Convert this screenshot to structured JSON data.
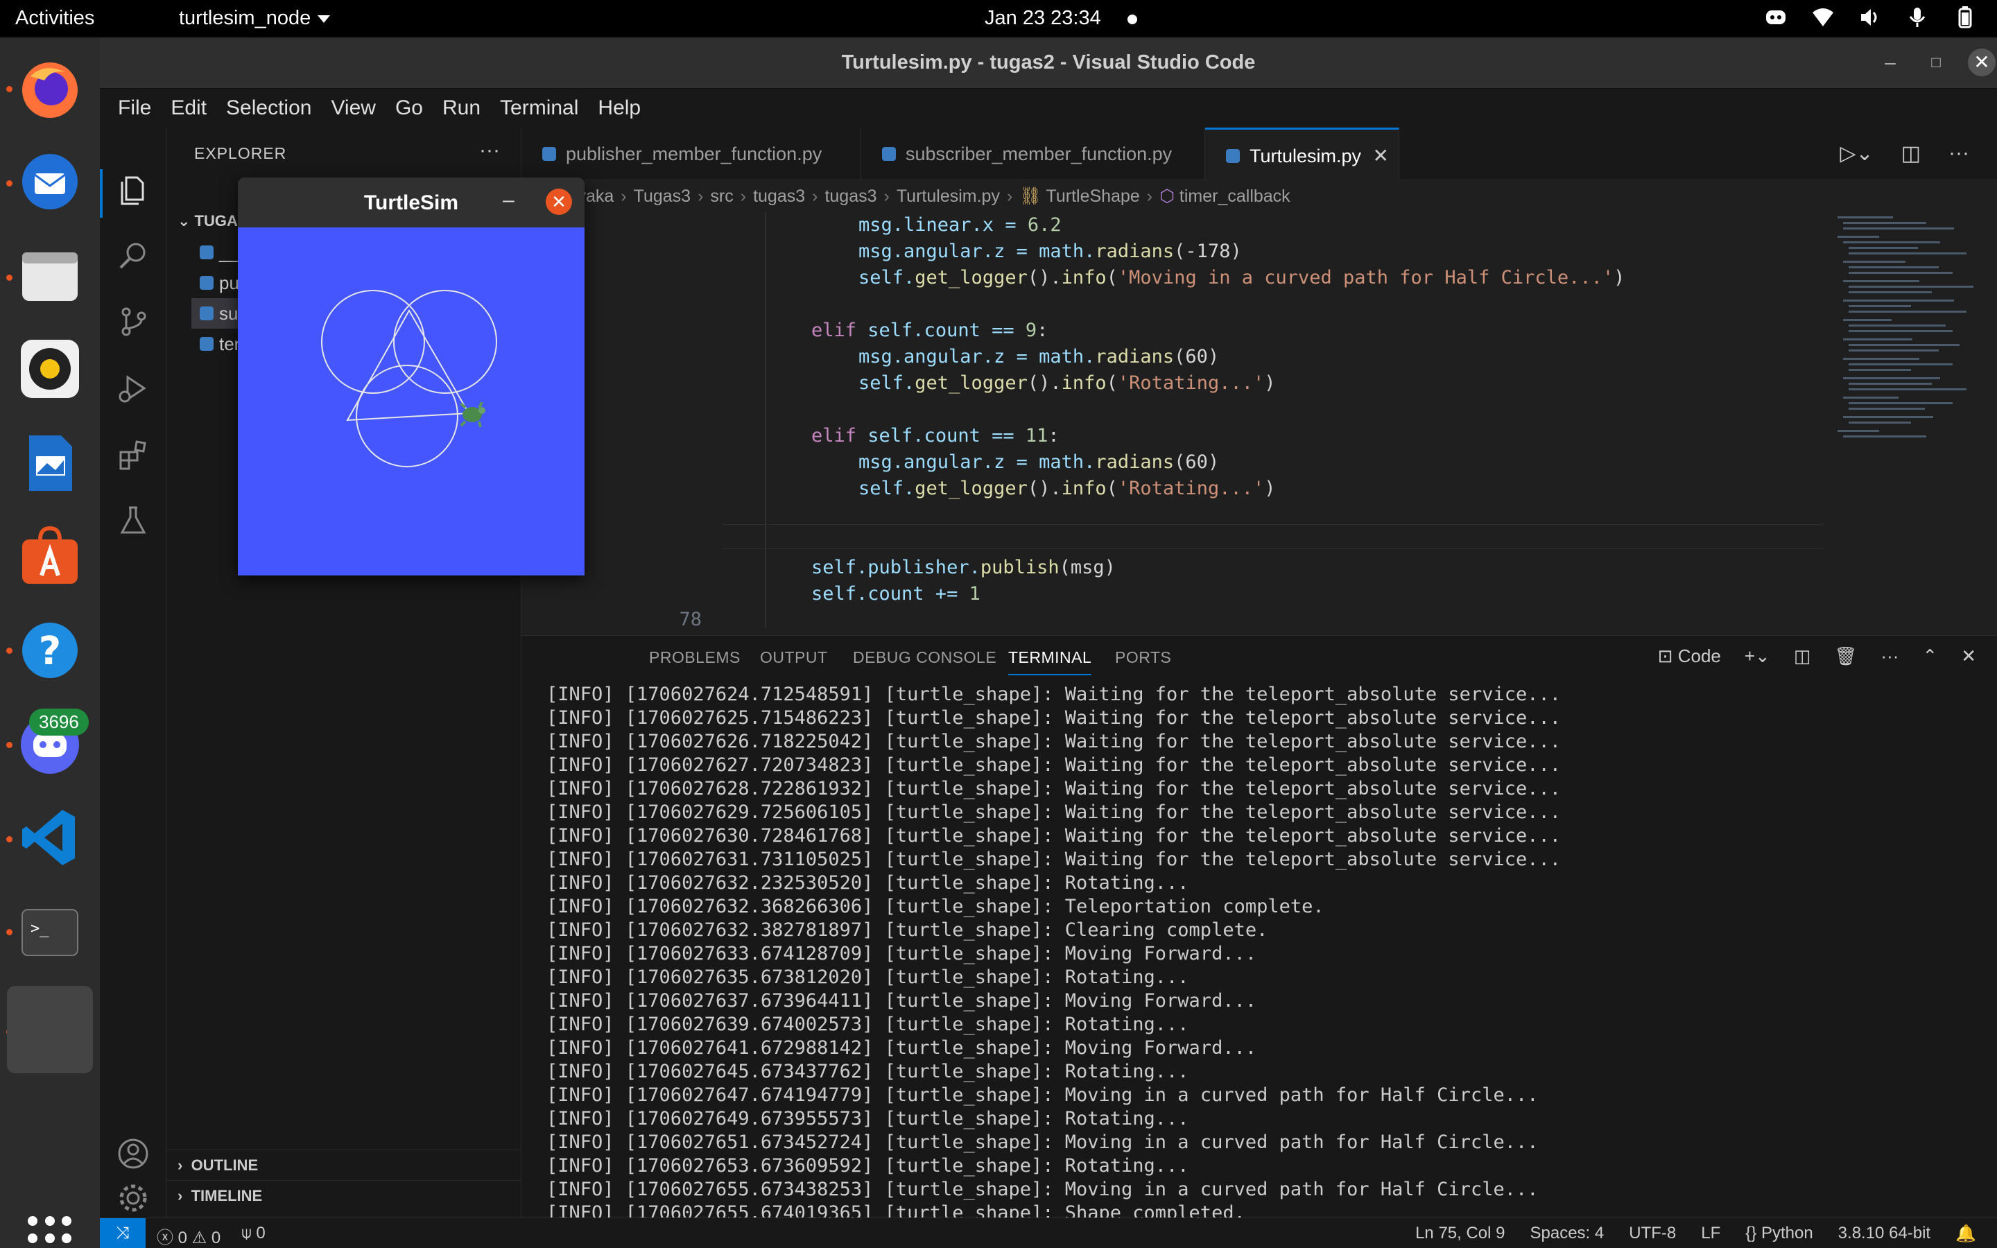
{
  "topbar": {
    "activities": "Activities",
    "app_menu": "turtlesim_node",
    "clock": "Jan 23  23:34"
  },
  "dock": {
    "discord_badge": "3696",
    "icons": [
      "firefox-icon",
      "thunderbird-icon",
      "files-icon",
      "rhythmbox-icon",
      "writer-icon",
      "app-center-icon",
      "help-icon",
      "discord-icon",
      "vscode-icon",
      "terminal-icon",
      "blank-app-icon",
      "show-apps-icon"
    ]
  },
  "window": {
    "title": "Turtulesim.py - tugas2 - Visual Studio Code"
  },
  "menu": [
    "File",
    "Edit",
    "Selection",
    "View",
    "Go",
    "Run",
    "Terminal",
    "Help"
  ],
  "sidebar": {
    "header": "EXPLORER",
    "project": "TUGA",
    "files": [
      "__i",
      "pul",
      "sub",
      "ter"
    ],
    "outline": "OUTLINE",
    "timeline": "TIMELINE"
  },
  "turtlesim": {
    "title": "TurtleSim"
  },
  "tabs": [
    {
      "label": "publisher_member_function.py"
    },
    {
      "label": "subscriber_member_function.py"
    },
    {
      "label": "Turtulesim.py"
    }
  ],
  "breadcrumb": [
    "e",
    "aryaka",
    "Tugas3",
    "src",
    "tugas3",
    "tugas3",
    "Turtulesim.py",
    "TurtleShape",
    "timer_callback"
  ],
  "editor": {
    "line_number": "78",
    "lines": {
      "l1a": "msg.linear.x = ",
      "l1b": "6.2",
      "l2a": "msg.angular.z = math.",
      "l2b": "radians",
      "l2c": "(-178)",
      "l3a": "self.",
      "l3b": "get_logger",
      "l3c": "().",
      "l3d": "info",
      "l3e": "(",
      "l3f": "'Moving in a curved path for Half Circle...'",
      "l3g": ")",
      "l4a": "elif",
      "l4b": " self.count == ",
      "l4c": "9",
      "l4d": ":",
      "l5a": "msg.angular.z = math.",
      "l5b": "radians",
      "l5c": "(60)",
      "l6a": "self.",
      "l6b": "get_logger",
      "l6c": "().",
      "l6d": "info",
      "l6e": "(",
      "l6f": "'Rotating...'",
      "l6g": ")",
      "l7a": "elif",
      "l7b": " self.count == ",
      "l7c": "11",
      "l7d": ":",
      "l8a": "msg.angular.z = math.",
      "l8b": "radians",
      "l8c": "(60)",
      "l9a": "self.",
      "l9b": "get_logger",
      "l9c": "().",
      "l9d": "info",
      "l9e": "(",
      "l9f": "'Rotating...'",
      "l9g": ")",
      "l10a": "self.publisher.",
      "l10b": "publish",
      "l10c": "(msg)",
      "l11a": "self.count += ",
      "l11b": "1"
    }
  },
  "panel": {
    "tabs": [
      "PROBLEMS",
      "OUTPUT",
      "DEBUG CONSOLE",
      "TERMINAL",
      "PORTS"
    ],
    "terminal_name": "Code",
    "lines": [
      "[INFO] [1706027624.712548591] [turtle_shape]: Waiting for the teleport_absolute service...",
      "[INFO] [1706027625.715486223] [turtle_shape]: Waiting for the teleport_absolute service...",
      "[INFO] [1706027626.718225042] [turtle_shape]: Waiting for the teleport_absolute service...",
      "[INFO] [1706027627.720734823] [turtle_shape]: Waiting for the teleport_absolute service...",
      "[INFO] [1706027628.722861932] [turtle_shape]: Waiting for the teleport_absolute service...",
      "[INFO] [1706027629.725606105] [turtle_shape]: Waiting for the teleport_absolute service...",
      "[INFO] [1706027630.728461768] [turtle_shape]: Waiting for the teleport_absolute service...",
      "[INFO] [1706027631.731105025] [turtle_shape]: Waiting for the teleport_absolute service...",
      "[INFO] [1706027632.232530520] [turtle_shape]: Rotating...",
      "[INFO] [1706027632.368266306] [turtle_shape]: Teleportation complete.",
      "[INFO] [1706027632.382781897] [turtle_shape]: Clearing complete.",
      "[INFO] [1706027633.674128709] [turtle_shape]: Moving Forward...",
      "[INFO] [1706027635.673812020] [turtle_shape]: Rotating...",
      "[INFO] [1706027637.673964411] [turtle_shape]: Moving Forward...",
      "[INFO] [1706027639.674002573] [turtle_shape]: Rotating...",
      "[INFO] [1706027641.672988142] [turtle_shape]: Moving Forward...",
      "[INFO] [1706027645.673437762] [turtle_shape]: Rotating...",
      "[INFO] [1706027647.674194779] [turtle_shape]: Moving in a curved path for Half Circle...",
      "[INFO] [1706027649.673955573] [turtle_shape]: Rotating...",
      "[INFO] [1706027651.673452724] [turtle_shape]: Moving in a curved path for Half Circle...",
      "[INFO] [1706027653.673609592] [turtle_shape]: Rotating...",
      "[INFO] [1706027655.673438253] [turtle_shape]: Moving in a curved path for Half Circle...",
      "[INFO] [1706027655.674019365] [turtle_shape]: Shape completed."
    ]
  },
  "status": {
    "errors": "0",
    "warnings": "0",
    "ports": "0",
    "position": "Ln 75, Col 9",
    "spaces": "Spaces: 4",
    "encoding": "UTF-8",
    "eol": "LF",
    "language": "Python",
    "interpreter": "3.8.10 64-bit"
  },
  "colors": {
    "accent": "#0078d4",
    "turtlesim_bg": "#4556ff",
    "ubuntu_orange": "#e95420"
  }
}
